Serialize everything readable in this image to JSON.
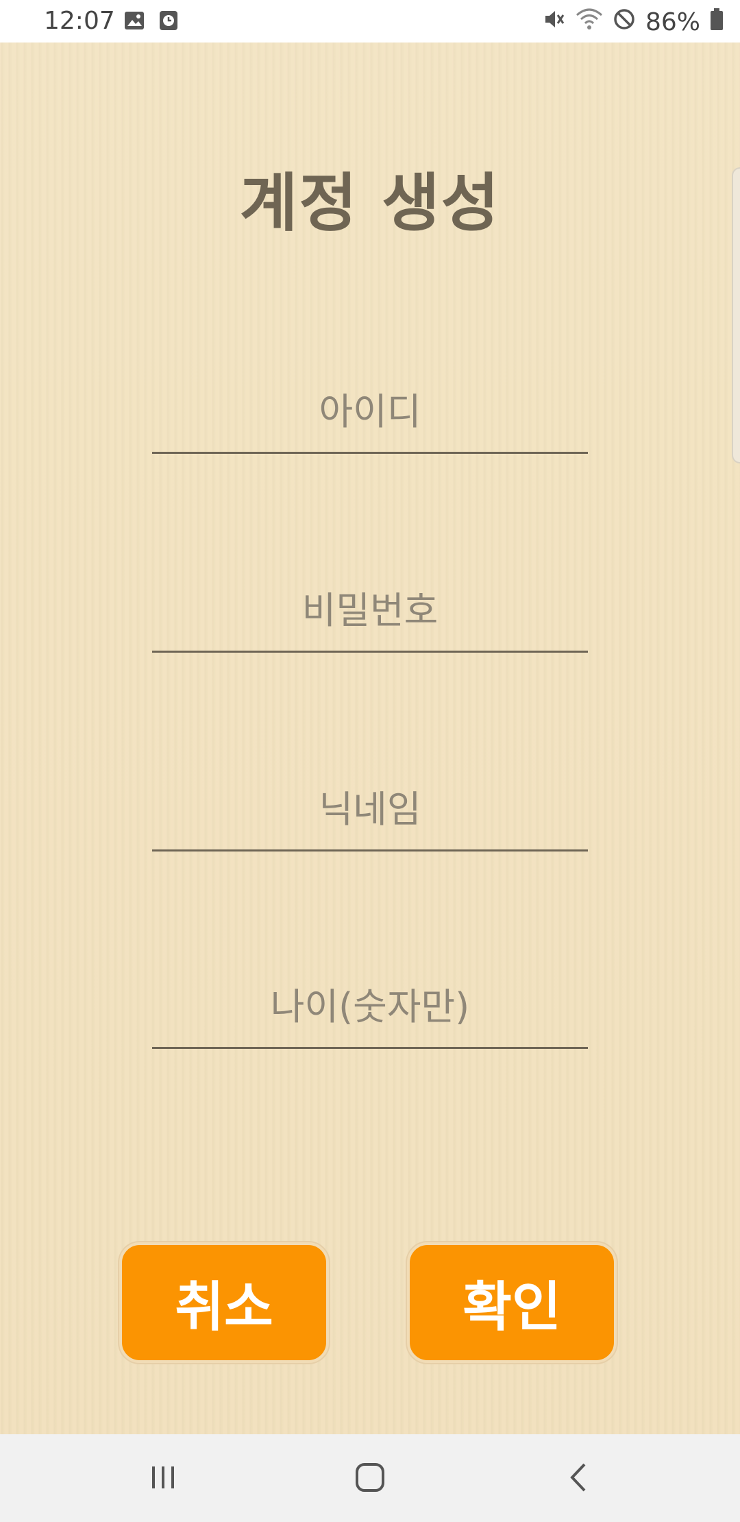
{
  "status_bar": {
    "time": "12:07",
    "battery": "86%",
    "icons": [
      "image-icon",
      "clock-icon",
      "mute-icon",
      "wifi-icon",
      "no-disturb-icon",
      "battery-icon"
    ]
  },
  "page": {
    "title": "계정 생성"
  },
  "form": {
    "id_placeholder": "아이디",
    "password_placeholder": "비밀번호",
    "nickname_placeholder": "닉네임",
    "age_placeholder": "나이(숫자만)"
  },
  "buttons": {
    "cancel_label": "취소",
    "confirm_label": "확인"
  },
  "nav": {
    "icons": [
      "recent-apps-icon",
      "home-icon",
      "back-icon"
    ]
  },
  "colors": {
    "background": "#f1e2c1",
    "title": "#6f6553",
    "accent_button": "#fb9402",
    "button_text": "#ffffff"
  }
}
